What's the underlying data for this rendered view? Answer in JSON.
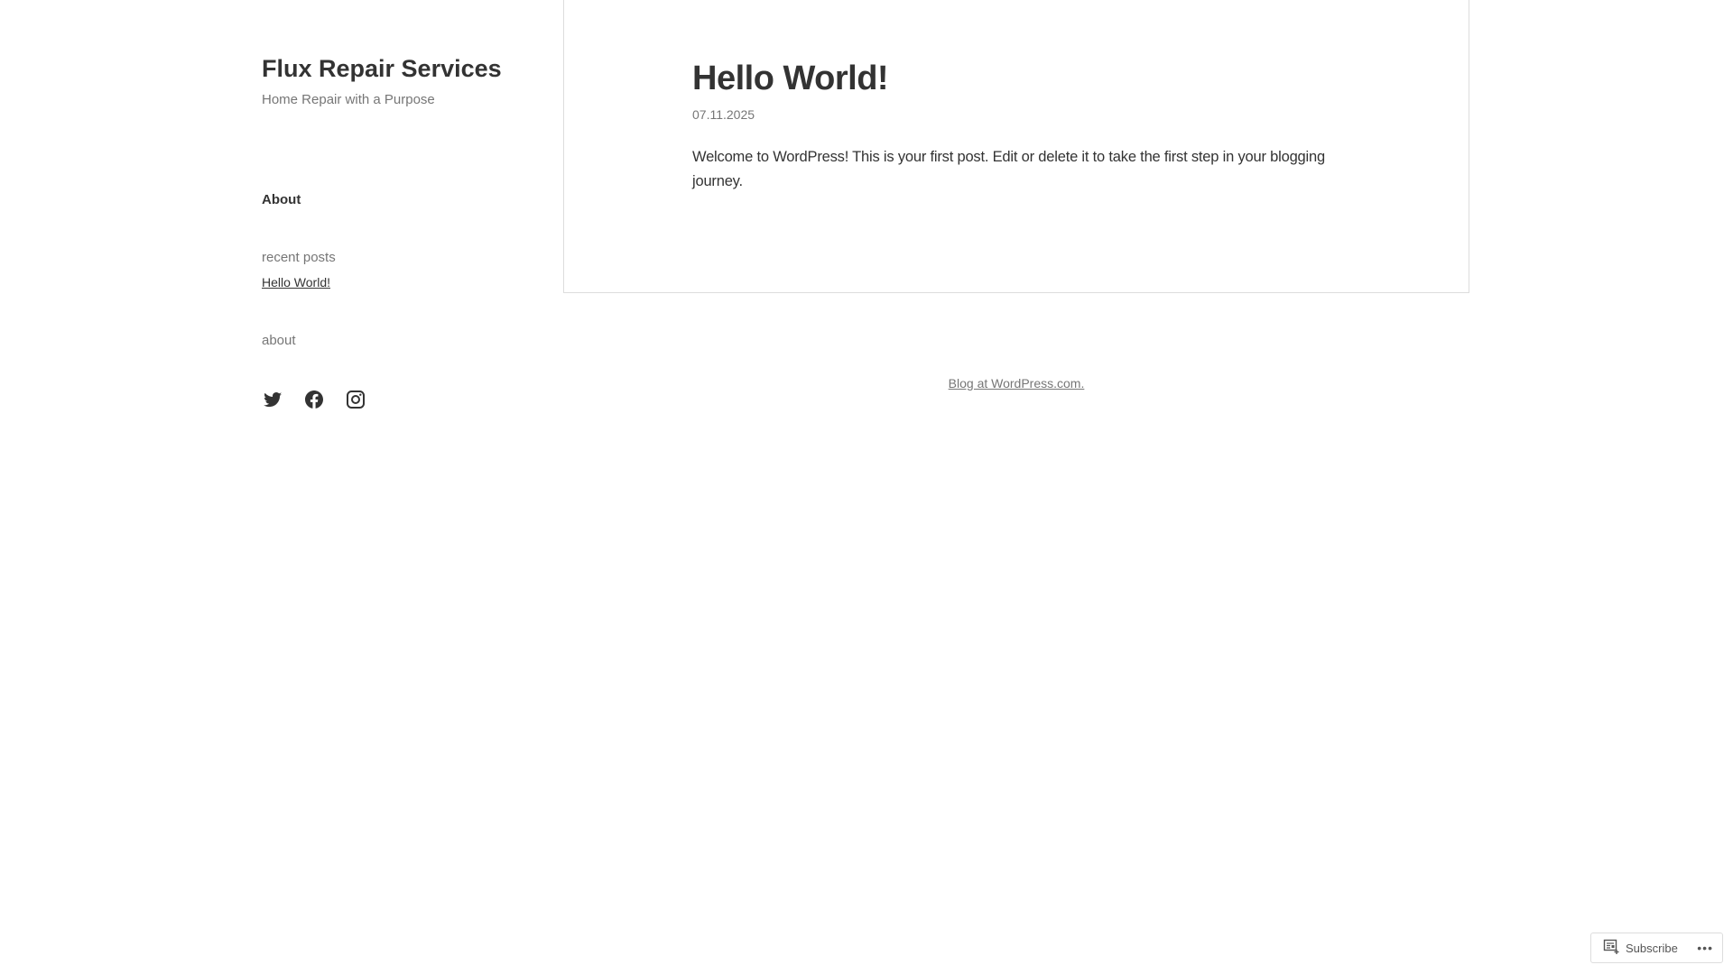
{
  "site": {
    "title": "Flux Repair Services",
    "tagline": "Home Repair with a Purpose"
  },
  "sidebar": {
    "nav_about": "About",
    "recent_posts_title": "recent posts",
    "recent_posts": [
      "Hello World!"
    ],
    "about_title": "about",
    "social_icons": [
      "twitter-icon",
      "facebook-icon",
      "instagram-icon"
    ]
  },
  "post": {
    "title": "Hello World!",
    "date": "07.11.2025",
    "body": "Welcome to WordPress! This is your first post. Edit or delete it to take the first step in your blogging journey."
  },
  "footer": {
    "credit": "Blog at WordPress.com."
  },
  "subscribe_bar": {
    "label": "Subscribe",
    "more": "•••"
  }
}
